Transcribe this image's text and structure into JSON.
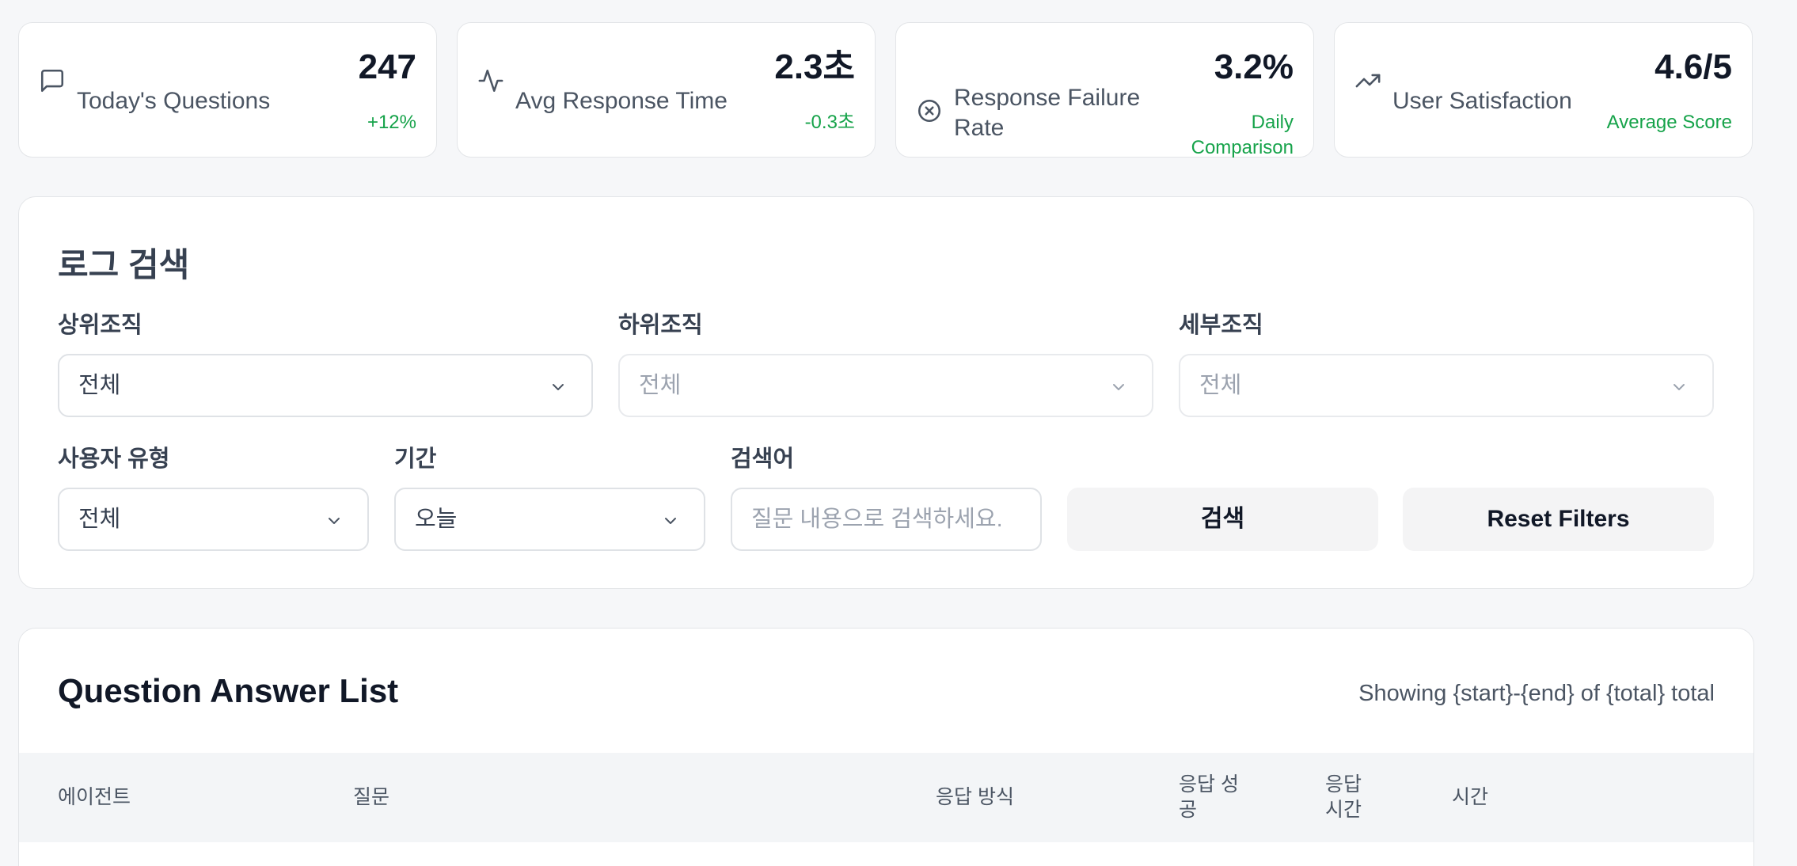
{
  "stats": [
    {
      "label": "Today's Questions",
      "value": "247",
      "delta": "+12%",
      "icon": "message-square-icon"
    },
    {
      "label": "Avg Response Time",
      "value": "2.3초",
      "delta": "-0.3초",
      "icon": "activity-icon"
    },
    {
      "label_line1": "Response Failure",
      "label_line2": "Rate",
      "value": "3.2%",
      "delta_line1": "Daily",
      "delta_line2": "Comparison",
      "icon": "x-circle-icon"
    },
    {
      "label": "User Satisfaction",
      "value": "4.6/5",
      "delta": "Average Score",
      "icon": "trending-up-icon"
    }
  ],
  "search": {
    "title": "로그 검색",
    "upper_org": {
      "label": "상위조직",
      "value": "전체"
    },
    "lower_org": {
      "label": "하위조직",
      "value": "전체"
    },
    "detail_org": {
      "label": "세부조직",
      "value": "전체"
    },
    "user_type": {
      "label": "사용자 유형",
      "value": "전체"
    },
    "period": {
      "label": "기간",
      "value": "오늘"
    },
    "keyword": {
      "label": "검색어",
      "placeholder": "질문 내용으로 검색하세요."
    },
    "search_button": "검색",
    "reset_button": "Reset Filters"
  },
  "list": {
    "title": "Question Answer List",
    "summary": "Showing {start}-{end} of {total} total",
    "columns": {
      "agent": "에이전트",
      "question": "질문",
      "method": "응답 방식",
      "success_l1": "응답 성",
      "success_l2": "공",
      "time_l1": "응답",
      "time_l2": "시간",
      "datetime": "시간"
    }
  },
  "colors": {
    "positive": "#16a34a",
    "border": "#e3e5e8",
    "background": "#f6f7f9"
  }
}
